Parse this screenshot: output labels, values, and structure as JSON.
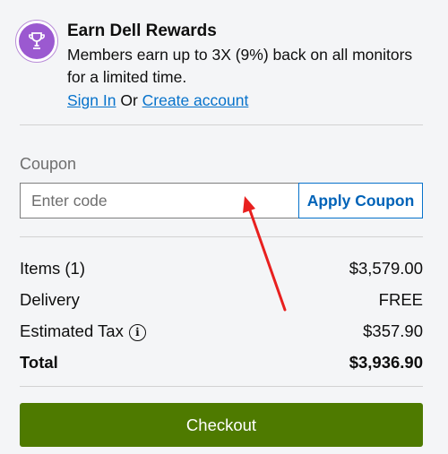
{
  "rewards": {
    "icon": "trophy-icon",
    "title": "Earn Dell Rewards",
    "description": "Members earn up to 3X (9%) back on all monitors for a limited time.",
    "sign_in_label": "Sign In",
    "or_text": " Or ",
    "create_account_label": "Create account"
  },
  "coupon": {
    "label": "Coupon",
    "placeholder": "Enter code",
    "value": "",
    "apply_label": "Apply Coupon"
  },
  "summary": {
    "items_label": "Items (1)",
    "items_value": "$3,579.00",
    "delivery_label": "Delivery",
    "delivery_value": "FREE",
    "tax_label": "Estimated Tax",
    "tax_icon": "i",
    "tax_value": "$357.90",
    "total_label": "Total",
    "total_value": "$3,936.90"
  },
  "checkout": {
    "label": "Checkout"
  },
  "colors": {
    "accent_link": "#0672cb",
    "checkout_green": "#4e7a00",
    "rewards_purple": "#9b59d0",
    "annotation_arrow": "#e8201f"
  }
}
